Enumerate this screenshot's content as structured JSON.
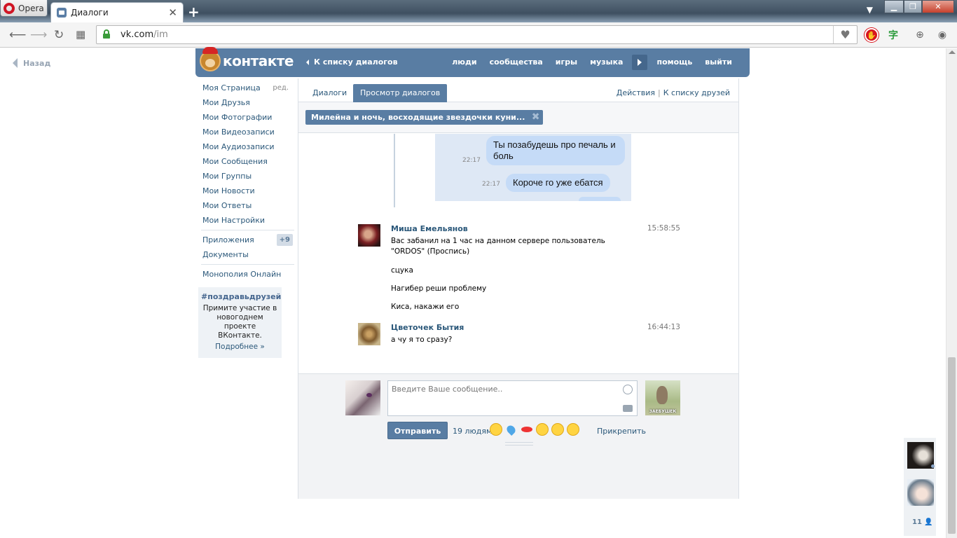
{
  "browser": {
    "menu_label": "Opera",
    "tab_title": "Диалоги",
    "url_host": "vk.com",
    "url_path": "/im"
  },
  "page": {
    "back_label": "Назад",
    "logo_text": "контакте",
    "to_dialogs": "К списку диалогов",
    "topnav": [
      "люди",
      "сообщества",
      "игры",
      "музыка",
      "помощь",
      "выйти"
    ],
    "left_menu": [
      {
        "label": "Моя Страница",
        "side": "ред."
      },
      {
        "label": "Мои Друзья"
      },
      {
        "label": "Мои Фотографии"
      },
      {
        "label": "Мои Видеозаписи"
      },
      {
        "label": "Мои Аудиозаписи"
      },
      {
        "label": "Мои Сообщения"
      },
      {
        "label": "Мои Группы"
      },
      {
        "label": "Мои Новости"
      },
      {
        "label": "Мои Ответы"
      },
      {
        "label": "Мои Настройки"
      }
    ],
    "apps": {
      "label": "Приложения",
      "badge": "+9"
    },
    "docs": "Документы",
    "monopoly": "Монополия Онлайн",
    "promo": {
      "tag": "#поздравьдрузей",
      "text": "Примите участие в новогоднем проекте ВКонтакте.",
      "more": "Подробнее »"
    }
  },
  "tabs": {
    "dialogs": "Диалоги",
    "view": "Просмотр диалогов",
    "actions": "Действия",
    "separator": "|",
    "friends_list": "К списку друзей"
  },
  "chip": {
    "title": "Милейна и ночь, восходящие звездочки куни..."
  },
  "screenshot_bubbles": [
    {
      "time": "22:17",
      "text": "Ты позабудешь про печаль и боль"
    },
    {
      "time": "22:17",
      "text": "Короче го уже ебатся"
    }
  ],
  "messages": [
    {
      "name": "Миша Емельянов",
      "time": "15:58:55",
      "lines": [
        "Вас забанил на 1 час на данном сервере пользователь \"ORDOS\" (Проспись)",
        "сцука",
        "Нагибер реши проблему",
        "Киса, накажи его"
      ]
    },
    {
      "name": "Цветочек Бытия",
      "time": "16:44:13",
      "lines": [
        "а чу я то сразу?"
      ]
    }
  ],
  "composer": {
    "placeholder": "Введите Ваше сообщение..",
    "send": "Отправить",
    "people": "19 людям",
    "attach": "Прикрепить",
    "peer_caption": "ЗАЕБУШЕК"
  },
  "friends_count": "11"
}
